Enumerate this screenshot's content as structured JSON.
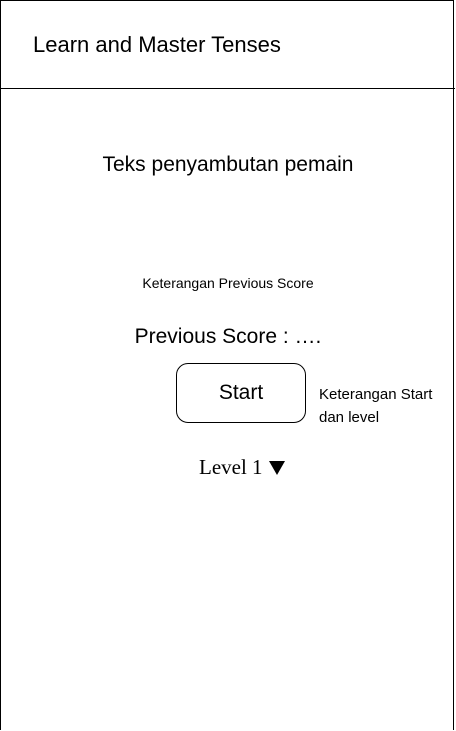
{
  "header": {
    "title": "Learn and Master Tenses"
  },
  "main": {
    "welcome_text": "Teks penyambutan pemain",
    "previous_score_note": "Keterangan Previous Score",
    "previous_score_label": "Previous Score : ….",
    "start_button_label": "Start",
    "start_level_note": "Keterangan Start dan level",
    "level_select_value": "Level 1",
    "level_select_icon": "triangle-down-icon"
  }
}
